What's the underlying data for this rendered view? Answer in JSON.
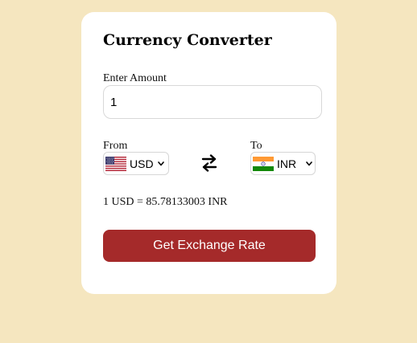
{
  "app": {
    "title": "Currency Converter"
  },
  "amount": {
    "label": "Enter Amount",
    "value": "1"
  },
  "from": {
    "label": "From",
    "currency": "USD",
    "flag_icon": "us-flag-icon"
  },
  "to": {
    "label": "To",
    "currency": "INR",
    "flag_icon": "india-flag-icon"
  },
  "swap_icon": "swap-arrows-icon",
  "result": {
    "text": "1 USD = 85.78133003 INR"
  },
  "action": {
    "button_label": "Get Exchange Rate"
  },
  "colors": {
    "page_background": "#f5e6bf",
    "card_background": "#ffffff",
    "button_background": "#a52a2a",
    "button_text": "#ffffff"
  }
}
